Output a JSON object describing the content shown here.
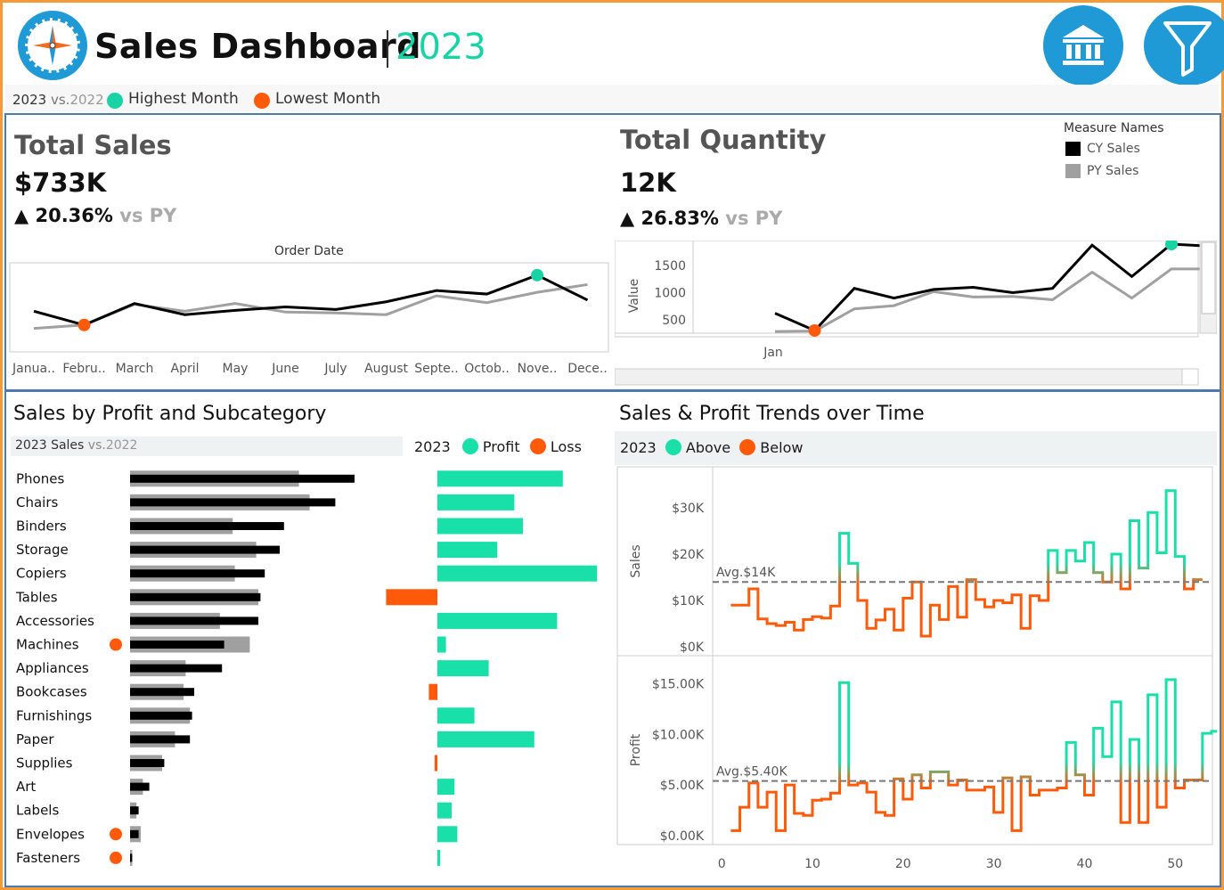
{
  "header": {
    "title": "Sales Dashboard",
    "year": "2023",
    "logo_icon": "compass-icon",
    "bank_icon": "bank-icon",
    "filter_icon": "filter-icon"
  },
  "legend": {
    "current": "2023",
    "vs": "vs.",
    "previous": "2022",
    "highest": "Highest Month",
    "lowest": "Lowest Month",
    "highest_color": "#19d3a5",
    "lowest_color": "#ff5a0a"
  },
  "kpi_sales": {
    "title": "Total Sales",
    "value": "$733K",
    "change": "20.36%",
    "vs": "vs PY",
    "axis_title": "Order Date",
    "months": [
      "Janua..",
      "Febru..",
      "March",
      "April",
      "May",
      "June",
      "July",
      "August",
      "Septe..",
      "Octob..",
      "Nove..",
      "Dece.."
    ],
    "cy": [
      38,
      22,
      47,
      34,
      39,
      43,
      40,
      49,
      62,
      58,
      80,
      51
    ],
    "py": [
      18,
      22,
      46,
      38,
      47,
      37,
      36,
      34,
      56,
      48,
      60,
      69
    ]
  },
  "kpi_quantity": {
    "title": "Total Quantity",
    "value": "12K",
    "change": "26.83%",
    "vs": "vs PY",
    "legend_title": "Measure Names",
    "cy_label": "CY Sales",
    "py_label": "PY Sales",
    "cy_color": "#000000",
    "py_color": "#a0a0a0",
    "y_label": "Value",
    "y_ticks": [
      "1500",
      "1000",
      "500"
    ],
    "x_label": "Jan",
    "cy": [
      620,
      300,
      1080,
      900,
      1060,
      1100,
      1000,
      1080,
      1880,
      1300,
      1900,
      1860
    ],
    "py": [
      280,
      290,
      700,
      760,
      1020,
      920,
      930,
      870,
      1380,
      900,
      1440,
      1440
    ]
  },
  "subcategory": {
    "title": "Sales by Profit and Subcategory",
    "sales_label": "2023 Sales",
    "vs": "vs.",
    "previous": "2022",
    "profit_year": "2023",
    "profit_label": "Profit",
    "loss_label": "Loss",
    "profit_color": "#19dfa8",
    "loss_color": "#ff5a0a",
    "items": [
      {
        "name": "Phones",
        "cy": 105,
        "py": 79,
        "profit": 44,
        "low": false
      },
      {
        "name": "Chairs",
        "cy": 96,
        "py": 84,
        "profit": 27,
        "low": false
      },
      {
        "name": "Binders",
        "cy": 72,
        "py": 48,
        "profit": 30,
        "low": false
      },
      {
        "name": "Storage",
        "cy": 70,
        "py": 59,
        "profit": 21,
        "low": false
      },
      {
        "name": "Copiers",
        "cy": 63,
        "py": 49,
        "profit": 56,
        "low": false
      },
      {
        "name": "Tables",
        "cy": 61,
        "py": 60,
        "profit": -18,
        "low": false
      },
      {
        "name": "Accessories",
        "cy": 60,
        "py": 42,
        "profit": 42,
        "low": false
      },
      {
        "name": "Machines",
        "cy": 44,
        "py": 56,
        "profit": 3,
        "low": true
      },
      {
        "name": "Appliances",
        "cy": 43,
        "py": 26,
        "profit": 18,
        "low": false
      },
      {
        "name": "Bookcases",
        "cy": 30,
        "py": 25,
        "profit": -3,
        "low": false
      },
      {
        "name": "Furnishings",
        "cy": 29,
        "py": 28,
        "profit": 13,
        "low": false
      },
      {
        "name": "Paper",
        "cy": 28,
        "py": 21,
        "profit": 34,
        "low": false
      },
      {
        "name": "Supplies",
        "cy": 16,
        "py": 15,
        "profit": -1,
        "low": false
      },
      {
        "name": "Art",
        "cy": 9,
        "py": 6,
        "profit": 6,
        "low": false
      },
      {
        "name": "Labels",
        "cy": 4,
        "py": 3,
        "profit": 5,
        "low": false
      },
      {
        "name": "Envelopes",
        "cy": 4,
        "py": 5,
        "profit": 7,
        "low": true
      },
      {
        "name": "Fasteners",
        "cy": 1,
        "py": 1,
        "profit": 1,
        "low": true
      }
    ]
  },
  "trends": {
    "title": "Sales & Profit Trends over Time",
    "year": "2023",
    "above_label": "Above",
    "below_label": "Below",
    "above_color": "#19dfa8",
    "below_color": "#ff5a0a",
    "sales_label": "Sales",
    "profit_label": "Profit",
    "sales_ticks": [
      "$30K",
      "$20K",
      "$10K",
      "$0K"
    ],
    "profit_ticks": [
      "$15.00K",
      "$10.00K",
      "$5.00K",
      "$0.00K"
    ],
    "sales_avg_label": "Avg.$14K",
    "profit_avg_label": "Avg.$5.40K",
    "x_ticks": [
      "0",
      "10",
      "20",
      "30",
      "40",
      "50"
    ]
  },
  "chart_data": [
    {
      "type": "line",
      "title": "Total Sales",
      "xlabel": "Order Date",
      "categories": [
        "January",
        "February",
        "March",
        "April",
        "May",
        "June",
        "July",
        "August",
        "September",
        "October",
        "November",
        "December"
      ],
      "series": [
        {
          "name": "CY Sales",
          "values": [
            38,
            22,
            47,
            34,
            39,
            43,
            40,
            49,
            62,
            58,
            80,
            51
          ]
        },
        {
          "name": "PY Sales",
          "values": [
            18,
            22,
            46,
            38,
            47,
            37,
            36,
            34,
            56,
            48,
            60,
            69
          ]
        }
      ]
    },
    {
      "type": "line",
      "title": "Total Quantity",
      "ylabel": "Value",
      "ylim": [
        250,
        1900
      ],
      "series": [
        {
          "name": "CY Sales",
          "values": [
            620,
            300,
            1080,
            900,
            1060,
            1100,
            1000,
            1080,
            1880,
            1300,
            1900,
            1860
          ]
        },
        {
          "name": "PY Sales",
          "values": [
            280,
            290,
            700,
            760,
            1020,
            920,
            930,
            870,
            1380,
            900,
            1440,
            1440
          ]
        }
      ]
    },
    {
      "type": "line",
      "title": "Sales & Profit Trends over Time",
      "ylabel": "Sales",
      "ylim": [
        0,
        35000
      ],
      "average": 14000,
      "x": [
        1,
        2,
        3,
        4,
        5,
        6,
        7,
        8,
        9,
        10,
        11,
        12,
        13,
        14,
        15,
        16,
        17,
        18,
        19,
        20,
        21,
        22,
        23,
        24,
        25,
        26,
        27,
        28,
        29,
        30,
        31,
        32,
        33,
        34,
        35,
        36,
        37,
        38,
        39,
        40,
        41,
        42,
        43,
        44,
        45,
        46,
        47,
        48,
        49,
        50,
        51,
        52
      ],
      "values": [
        9000,
        9000,
        12500,
        6000,
        5000,
        4600,
        5300,
        3600,
        5900,
        6500,
        6200,
        8800,
        24500,
        18000,
        10000,
        4000,
        5800,
        8100,
        3600,
        10500,
        14000,
        2300,
        9000,
        5900,
        13000,
        6400,
        14500,
        10200,
        8600,
        10000,
        9500,
        11200,
        4000,
        11000,
        10000,
        20800,
        16000,
        20800,
        18500,
        22500,
        16000,
        14000,
        20000,
        12500,
        27200,
        17000,
        29000,
        20300,
        33700,
        19500,
        12500,
        14500
      ]
    },
    {
      "type": "line",
      "title": "Sales & Profit Trends over Time",
      "ylabel": "Profit",
      "ylim": [
        0,
        16000
      ],
      "average": 5400,
      "x": [
        1,
        2,
        3,
        4,
        5,
        6,
        7,
        8,
        9,
        10,
        11,
        12,
        13,
        14,
        15,
        16,
        17,
        18,
        19,
        20,
        21,
        22,
        23,
        24,
        25,
        26,
        27,
        28,
        29,
        30,
        31,
        32,
        33,
        34,
        35,
        36,
        37,
        38,
        39,
        40,
        41,
        42,
        43,
        44,
        45,
        46,
        47,
        48,
        49,
        50,
        51,
        52
      ],
      "values": [
        500,
        2800,
        5200,
        2800,
        4300,
        500,
        5000,
        2200,
        2000,
        3500,
        3600,
        4200,
        15100,
        5000,
        5200,
        4300,
        2300,
        2000,
        5600,
        3600,
        6000,
        4700,
        6300,
        6300,
        5000,
        5500,
        4500,
        4500,
        4800,
        2300,
        5700,
        500,
        5800,
        4000,
        4500,
        4500,
        4700,
        9200,
        6000,
        4000,
        10600,
        7800,
        13200,
        1300,
        9500,
        1300,
        13900,
        2800,
        15400,
        4700,
        5500,
        5500,
        10100,
        10300,
        4500
      ]
    }
  ]
}
